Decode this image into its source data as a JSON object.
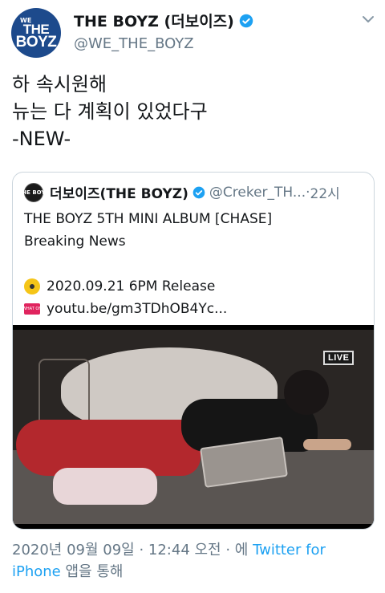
{
  "author": {
    "avatar_text_top": "WE",
    "avatar_text_1": "THE",
    "avatar_text_2": "BOYZ",
    "display_name": "THE BOYZ (더보이즈)",
    "handle": "@WE_THE_BOYZ",
    "verified_icon": "verified-badge-icon"
  },
  "tweet": {
    "lines": [
      "하 속시원해",
      "뉴는 다 계획이 있었다구",
      "-NEW-"
    ]
  },
  "quoted": {
    "avatar_text": "THE BOYZ",
    "display_name": "더보이즈(THE BOYZ)",
    "handle": "@Creker_TH...",
    "separator": " · ",
    "time": "22시",
    "line1": "THE BOYZ 5TH MINI ALBUM [CHASE]",
    "line2": "Breaking News",
    "line3": "2020.09.21 6PM Release",
    "line4": "youtu.be/gm3TDhOB4Yc...",
    "tv_text": "WHAT ON"
  },
  "media": {
    "live_label": "LIVE"
  },
  "footer": {
    "timestamp": "2020년 09월 09일 · 12:44 오전 · 에 ",
    "source_a": "Twitter for",
    "source_b": "iPhone",
    "suffix": " 앱을 통해"
  },
  "colors": {
    "link": "#1da1f2",
    "muted": "#657786",
    "avatar_bg": "#1d4a8c"
  }
}
